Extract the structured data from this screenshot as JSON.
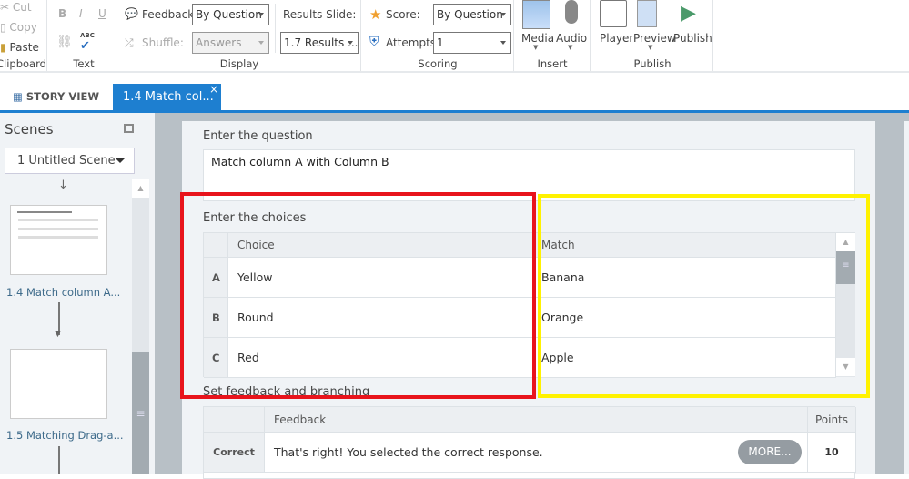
{
  "ribbon": {
    "clipboard": {
      "cut": "Cut",
      "copy": "Copy",
      "paste": "Paste",
      "label": "Clipboard"
    },
    "text": {
      "bold": "B",
      "italic": "I",
      "underline": "U",
      "spell": "ABC",
      "label": "Text"
    },
    "display": {
      "feedback_label": "Feedback:",
      "feedback_value": "By Question",
      "shuffle_label": "Shuffle:",
      "shuffle_value": "Answers",
      "results_label": "Results Slide:",
      "results_value": "1.7 Results ...",
      "label": "Display"
    },
    "scoring": {
      "score_label": "Score:",
      "score_value": "By Question",
      "attempts_label": "Attempts:",
      "attempts_value": "1",
      "label": "Scoring"
    },
    "insert": {
      "media": "Media",
      "audio": "Audio",
      "label": "Insert"
    },
    "publish": {
      "player": "Player",
      "preview": "Preview",
      "publish": "Publish",
      "label": "Publish"
    }
  },
  "tabs": {
    "story_view": "STORY VIEW",
    "active": "1.4 Match col...",
    "close": "×"
  },
  "scenes": {
    "title": "Scenes",
    "scene_select": "1 Untitled Scene",
    "slides": [
      {
        "label": "1.4 Match column A..."
      },
      {
        "label": "1.5 Matching Drag-a..."
      }
    ]
  },
  "editor": {
    "question_label": "Enter the question",
    "question_value": "Match column A with Column B",
    "choices_label": "Enter the choices",
    "choice_header": "Choice",
    "match_header": "Match",
    "rows": [
      {
        "letter": "A",
        "choice": "Yellow",
        "match": "Banana"
      },
      {
        "letter": "B",
        "choice": "Round",
        "match": "Orange"
      },
      {
        "letter": "C",
        "choice": "Red",
        "match": "Apple"
      }
    ],
    "feedback_label": "Set feedback and branching",
    "feedback_header": "Feedback",
    "points_header": "Points",
    "feedback_rows": [
      {
        "type": "Correct",
        "text": "That's right!  You selected the correct response.",
        "more": "MORE...",
        "points": "10"
      }
    ]
  },
  "colors": {
    "accent": "#1e7fd0",
    "highlight_red": "#e8141c",
    "highlight_yellow": "#fff200"
  }
}
